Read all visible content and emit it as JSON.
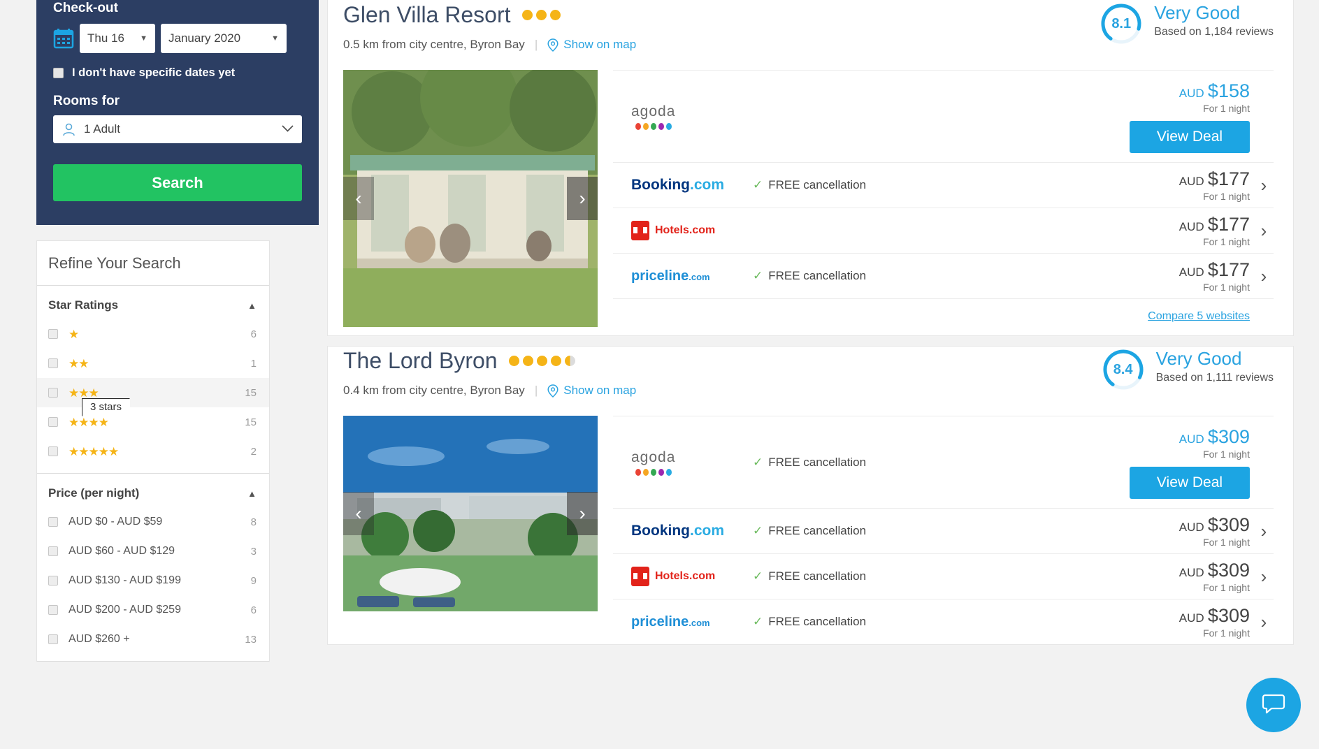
{
  "search_panel": {
    "checkout_label": "Check-out",
    "calendar_icon": "calendar-icon",
    "day_value": "Thu 16",
    "month_value": "January 2020",
    "caret": "▼",
    "no_dates_label": "I don't have specific dates yet",
    "rooms_label": "Rooms for",
    "guests_value": "1 Adult",
    "guest_icon": "person-icon",
    "guests_caret": "⌄",
    "search_button": "Search",
    "accent_bg": "#2c3e63",
    "search_button_color": "#22c362"
  },
  "refine": {
    "title": "Refine Your Search",
    "sections": [
      {
        "title": "Star Ratings",
        "collapse_icon": "▲",
        "rows": [
          {
            "stars": 1,
            "label": "★",
            "count": "6"
          },
          {
            "stars": 2,
            "label": "★★",
            "count": "1"
          },
          {
            "stars": 3,
            "label": "★★★",
            "count": "15",
            "hovered": true,
            "tooltip": "3 stars"
          },
          {
            "stars": 4,
            "label": "★★★★",
            "count": "15"
          },
          {
            "stars": 5,
            "label": "★★★★★",
            "count": "2"
          }
        ]
      },
      {
        "title": "Price (per night)",
        "collapse_icon": "▲",
        "rows": [
          {
            "label": "AUD $0 - AUD $59",
            "count": "8"
          },
          {
            "label": "AUD $60 - AUD $129",
            "count": "3"
          },
          {
            "label": "AUD $130 - AUD $199",
            "count": "9"
          },
          {
            "label": "AUD $200 - AUD $259",
            "count": "6"
          },
          {
            "label": "AUD $260 +",
            "count": "13"
          }
        ]
      }
    ]
  },
  "hotels": [
    {
      "name": "Glen Villa Resort",
      "dots_full": 3,
      "dots_half": 0,
      "distance": "0.5 km from city centre, Byron Bay",
      "map_link": "Show on map",
      "score": "8.1",
      "score_pct": 81,
      "score_label": "Very Good",
      "reviews": "Based on 1,184 reviews",
      "photo_alt": "resort cabin with veranda and guests",
      "prev_arrow": "‹",
      "next_arrow": "›",
      "deals": [
        {
          "provider": "agoda",
          "perk": "",
          "currency": "AUD",
          "price": "$158",
          "period": "For 1 night",
          "cta": "View Deal",
          "featured": true
        },
        {
          "provider": "Booking.com",
          "perk": "FREE cancellation",
          "currency": "AUD",
          "price": "$177",
          "period": "For 1 night",
          "chevron": "›"
        },
        {
          "provider": "Hotels.com",
          "perk": "",
          "currency": "AUD",
          "price": "$177",
          "period": "For 1 night",
          "chevron": "›"
        },
        {
          "provider": "priceline.com",
          "perk": "FREE cancellation",
          "currency": "AUD",
          "price": "$177",
          "period": "For 1 night",
          "chevron": "›"
        }
      ],
      "compare": "Compare 5 websites"
    },
    {
      "name": "The Lord Byron",
      "dots_full": 4,
      "dots_half": 1,
      "distance": "0.4 km from city centre, Byron Bay",
      "map_link": "Show on map",
      "score": "8.4",
      "score_pct": 84,
      "score_label": "Very Good",
      "reviews": "Based on 1,111 reviews",
      "photo_alt": "resort pool area with palm trees and umbrella",
      "prev_arrow": "‹",
      "next_arrow": "›",
      "deals": [
        {
          "provider": "agoda",
          "perk": "FREE cancellation",
          "currency": "AUD",
          "price": "$309",
          "period": "For 1 night",
          "cta": "View Deal",
          "featured": true
        },
        {
          "provider": "Booking.com",
          "perk": "FREE cancellation",
          "currency": "AUD",
          "price": "$309",
          "period": "For 1 night",
          "chevron": "›"
        },
        {
          "provider": "Hotels.com",
          "perk": "FREE cancellation",
          "currency": "AUD",
          "price": "$309",
          "period": "For 1 night",
          "chevron": "›"
        },
        {
          "provider": "priceline.com",
          "perk": "FREE cancellation",
          "currency": "AUD",
          "price": "$309",
          "period": "For 1 night",
          "chevron": "›"
        }
      ]
    }
  ],
  "chat_widget": {
    "icon": "chat-bubble-icon",
    "color": "#1ca5e3"
  }
}
